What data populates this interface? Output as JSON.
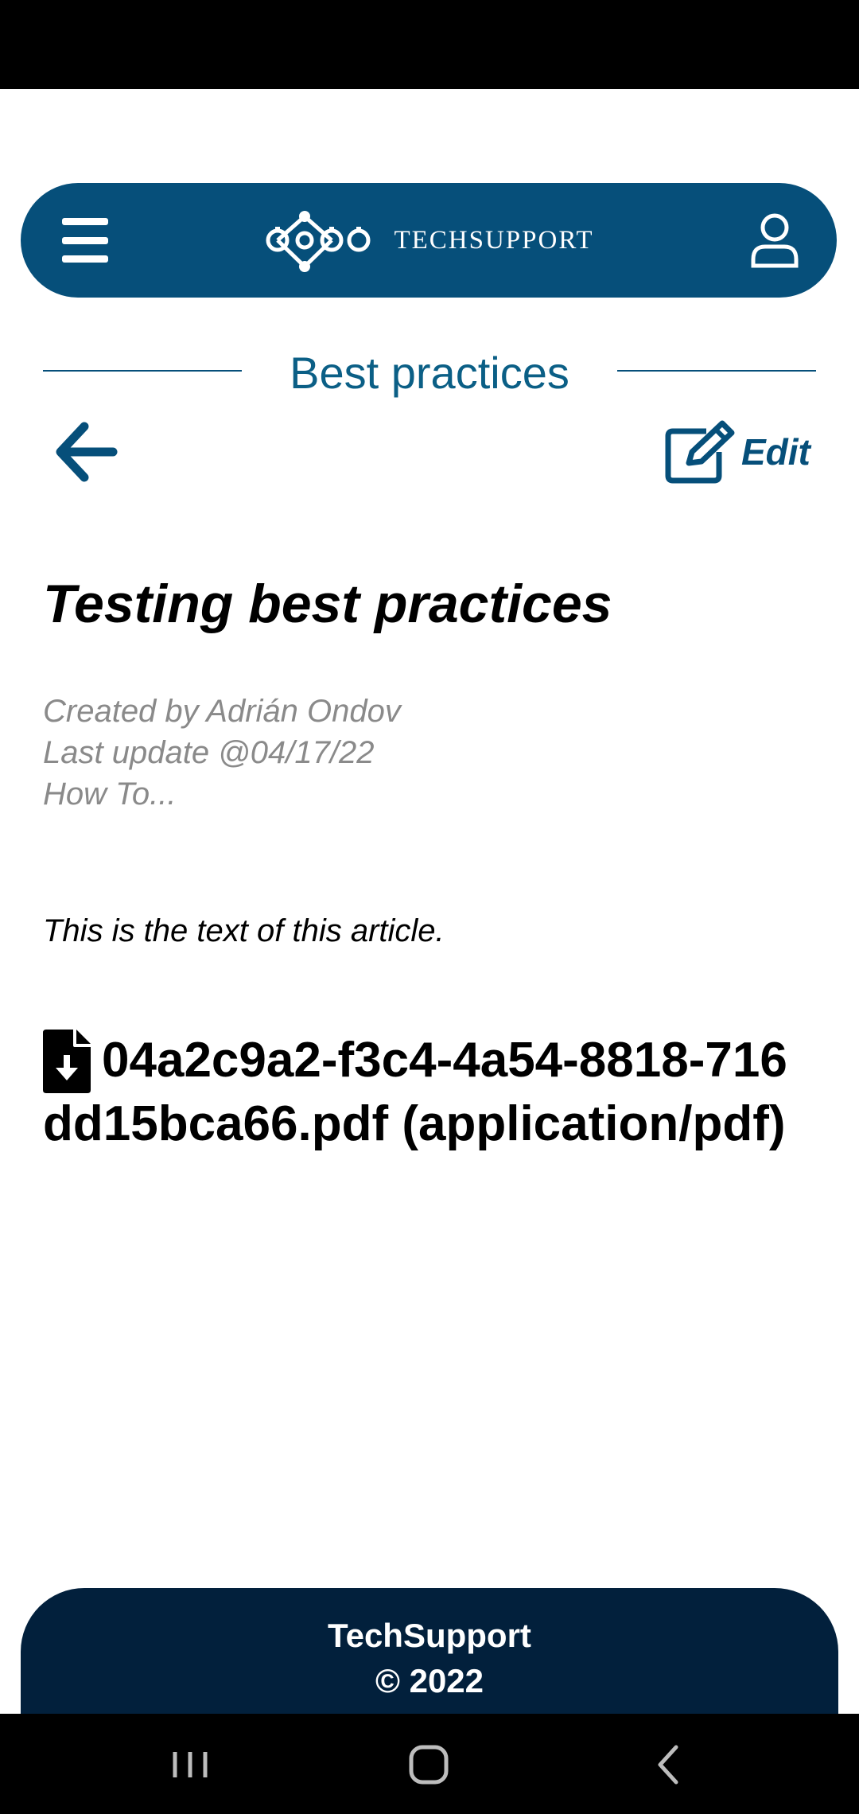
{
  "header": {
    "brand": "TECHSUPPORT"
  },
  "section": {
    "title": "Best practices"
  },
  "toolbar": {
    "edit_label": "Edit"
  },
  "article": {
    "title": "Testing best practices",
    "created_by": "Created by Adrián Ondov",
    "last_update": "Last update @04/17/22",
    "category": "How To...",
    "body": "This is the text of this article.",
    "attachment": "04a2c9a2-f3c4-4a54-8818-716dd15bca66.pdf (application/pdf)"
  },
  "footer": {
    "name": "TechSupport",
    "copyright": "© 2022"
  },
  "colors": {
    "header_bg": "#064f7a",
    "title_color": "#0b5f86",
    "footer_bg": "#02203c",
    "meta_text": "#8a8a8a"
  },
  "icons": {
    "menu": "hamburger-menu-icon",
    "logo": "gears-logo-icon",
    "user": "user-icon",
    "back": "arrow-left-icon",
    "edit": "edit-icon",
    "file": "file-download-icon",
    "nav_recent": "recent-apps-icon",
    "nav_home": "home-icon",
    "nav_back": "chevron-left-icon"
  }
}
